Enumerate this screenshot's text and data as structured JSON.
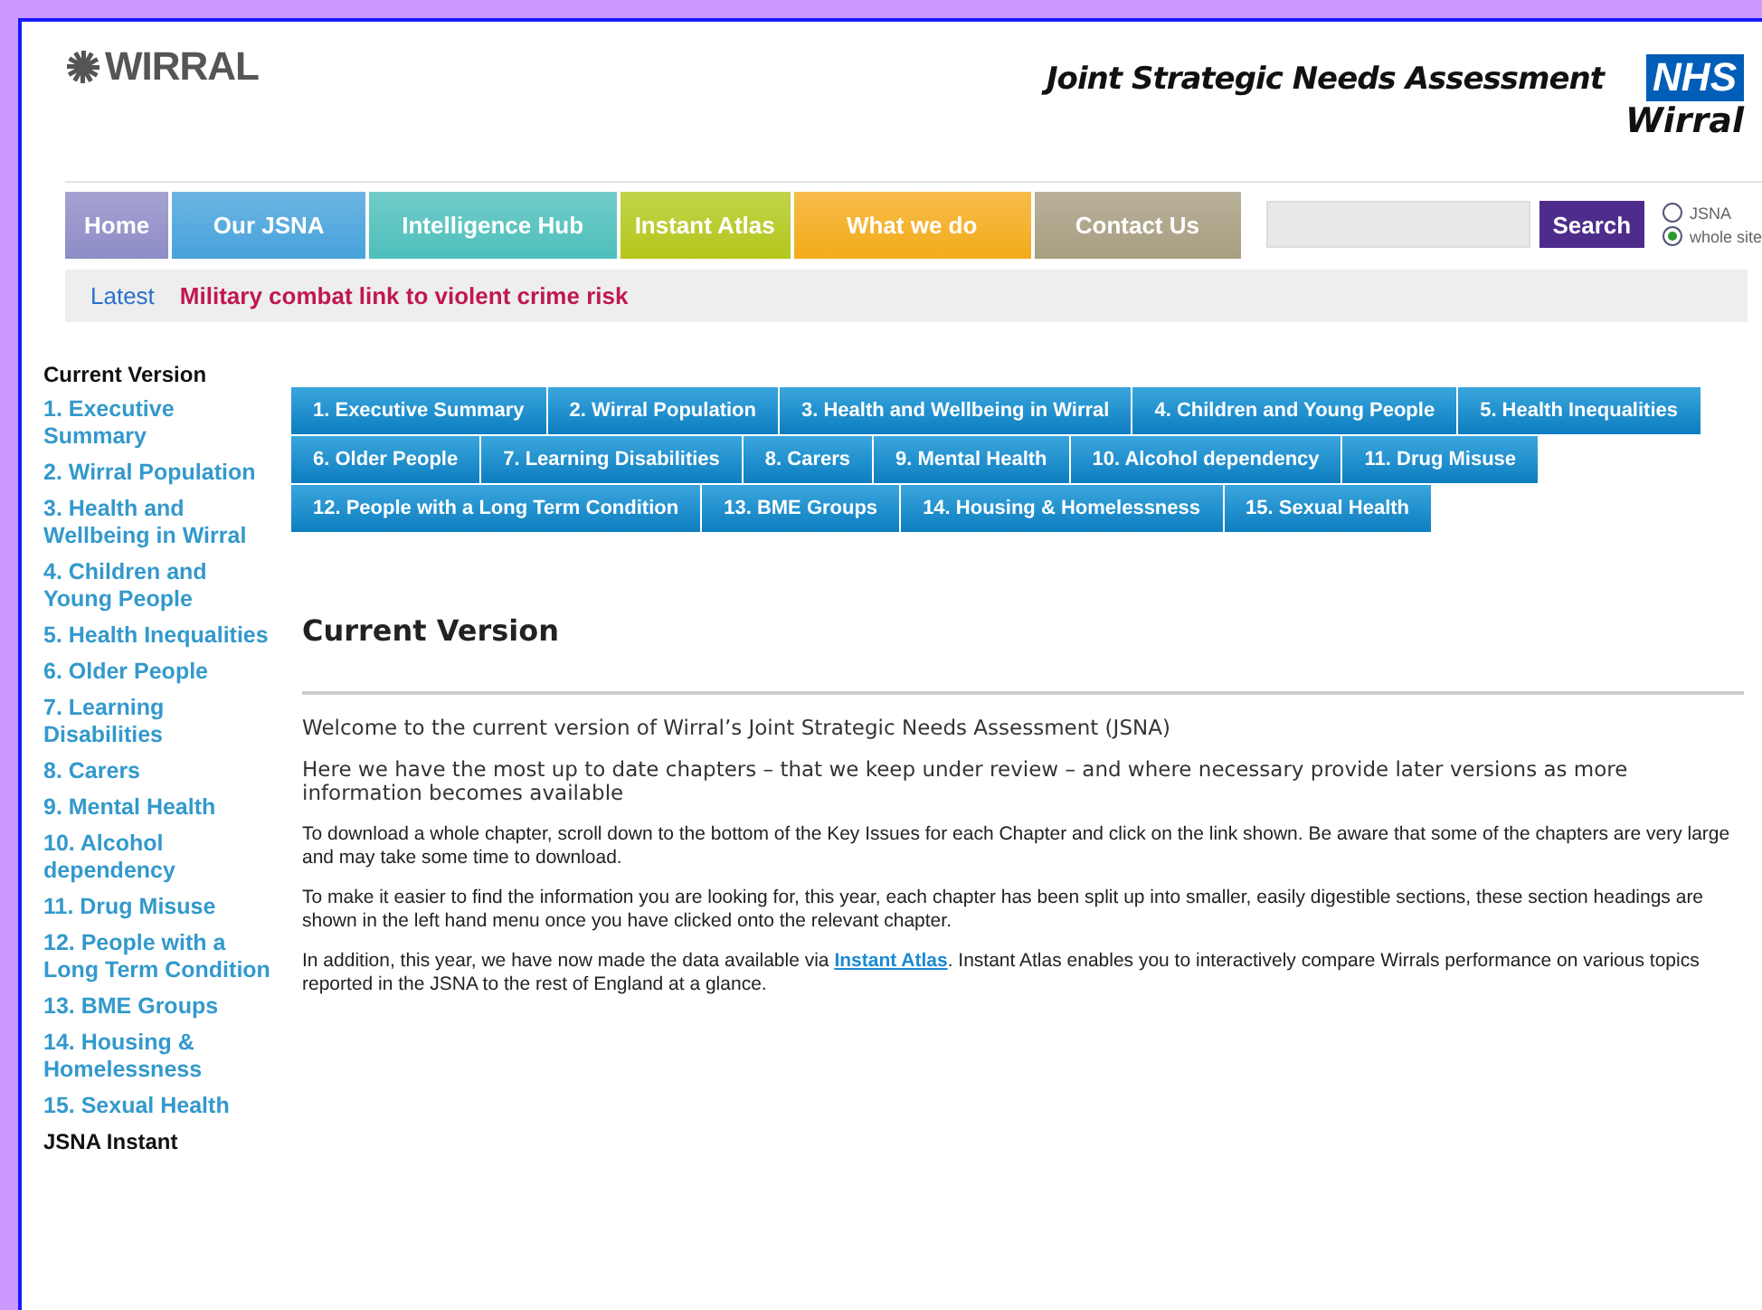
{
  "header": {
    "logo": "WIRRAL",
    "title": "Joint Strategic Needs Assessment",
    "nhs_badge": "NHS",
    "nhs_area": "Wirral"
  },
  "nav": [
    {
      "label": "Home",
      "color": "#8e8cc6"
    },
    {
      "label": "Our JSNA",
      "color": "#47a2dc"
    },
    {
      "label": "Intelligence Hub",
      "color": "#4ebfbb"
    },
    {
      "label": "Instant Atlas",
      "color": "#b3c71c"
    },
    {
      "label": "What we do",
      "color": "#f4ab1c"
    },
    {
      "label": "Contact Us",
      "color": "#a79e80"
    }
  ],
  "search": {
    "button": "Search",
    "scopes": [
      {
        "label": "JSNA",
        "selected": false
      },
      {
        "label": "whole site",
        "selected": true
      }
    ]
  },
  "latest": {
    "label": "Latest",
    "headline": "Military combat link to violent crime risk"
  },
  "sidebar": {
    "heading": "Current Version",
    "items": [
      "1. Executive Summary",
      "2. Wirral Population",
      "3. Health and Wellbeing in Wirral",
      "4. Children and Young People",
      "5. Health Inequalities",
      "6. Older People",
      "7. Learning Disabilities",
      "8. Carers",
      "9. Mental Health",
      "10. Alcohol dependency",
      "11. Drug Misuse",
      "12. People with a Long Term Condition",
      "13. BME Groups",
      "14. Housing & Homelessness",
      "15. Sexual Health"
    ],
    "footer_heading": "JSNA Instant"
  },
  "chapter_tabs": [
    [
      "1. Executive Summary",
      "2. Wirral Population",
      "3. Health and Wellbeing in Wirral",
      "4. Children and Young People",
      "5. Health Inequalities"
    ],
    [
      "6. Older People",
      "7. Learning Disabilities",
      "8. Carers",
      "9. Mental Health",
      "10. Alcohol dependency",
      "11. Drug Misuse"
    ],
    [
      "12. People with a Long Term Condition",
      "13. BME Groups",
      "14. Housing & Homelessness",
      "15. Sexual Health"
    ]
  ],
  "content": {
    "heading": "Current Version",
    "intro": [
      "Welcome to the current version of Wirral’s Joint Strategic Needs Assessment (JSNA)",
      "Here we have the most up to date chapters – that we keep under review – and where necessary provide later versions as more information becomes available"
    ],
    "paragraphs": [
      "To download a whole chapter, scroll down to the bottom of the Key Issues for each Chapter and click on the link shown. Be aware that some of the chapters are very large and may take some time to download.",
      "To make it easier to find the information you are looking for, this year, each chapter has been split up into smaller, easily digestible sections, these section headings are shown in the left hand menu once you have clicked onto the relevant chapter."
    ],
    "last_paragraph": {
      "before": "In addition, this year, we have now made the data available via ",
      "link": "Instant Atlas",
      "after": ". Instant Atlas enables you to interactively compare Wirrals performance on various topics reported in the JSNA to the rest of England at a glance."
    }
  }
}
